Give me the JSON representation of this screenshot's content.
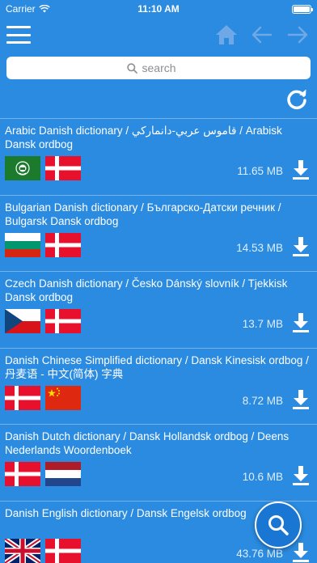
{
  "status_bar": {
    "carrier": "Carrier",
    "time": "11:10 AM",
    "battery_level": 1.0
  },
  "toolbar": {
    "menu_icon": "hamburger-menu-icon",
    "home_icon": "home-icon",
    "back_icon": "arrow-left-icon",
    "forward_icon": "arrow-right-icon"
  },
  "search": {
    "placeholder": "search"
  },
  "refresh_icon": "refresh-icon",
  "colors": {
    "background": "#2a8be0",
    "fab": "#1976d2"
  },
  "items": [
    {
      "title": "Arabic Danish dictionary / قاموس عربي-دانماركي / Arabisk Dansk ordbog",
      "size": "11.65 MB",
      "flags": [
        "arab-league",
        "denmark"
      ]
    },
    {
      "title": "Bulgarian Danish dictionary / Българско-Датски речник / Bulgarsk Dansk ordbog",
      "size": "14.53 MB",
      "flags": [
        "bulgaria",
        "denmark"
      ]
    },
    {
      "title": "Czech Danish dictionary / Česko Dánský slovník / Tjekkisk Dansk ordbog",
      "size": "13.7 MB",
      "flags": [
        "czech",
        "denmark"
      ]
    },
    {
      "title": "Danish Chinese Simplified dictionary / Dansk Kinesisk ordbog / 丹麦语 - 中文(简体) 字典",
      "size": "8.72 MB",
      "flags": [
        "denmark",
        "china"
      ]
    },
    {
      "title": "Danish Dutch dictionary / Dansk Hollandsk ordbog / Deens Nederlands Woordenboek",
      "size": "10.6 MB",
      "flags": [
        "denmark",
        "netherlands"
      ]
    },
    {
      "title": "Danish English dictionary / Dansk Engelsk ordbog",
      "size": "43.76 MB",
      "flags": [
        "uk",
        "denmark"
      ]
    }
  ],
  "fab_icon": "search-icon"
}
